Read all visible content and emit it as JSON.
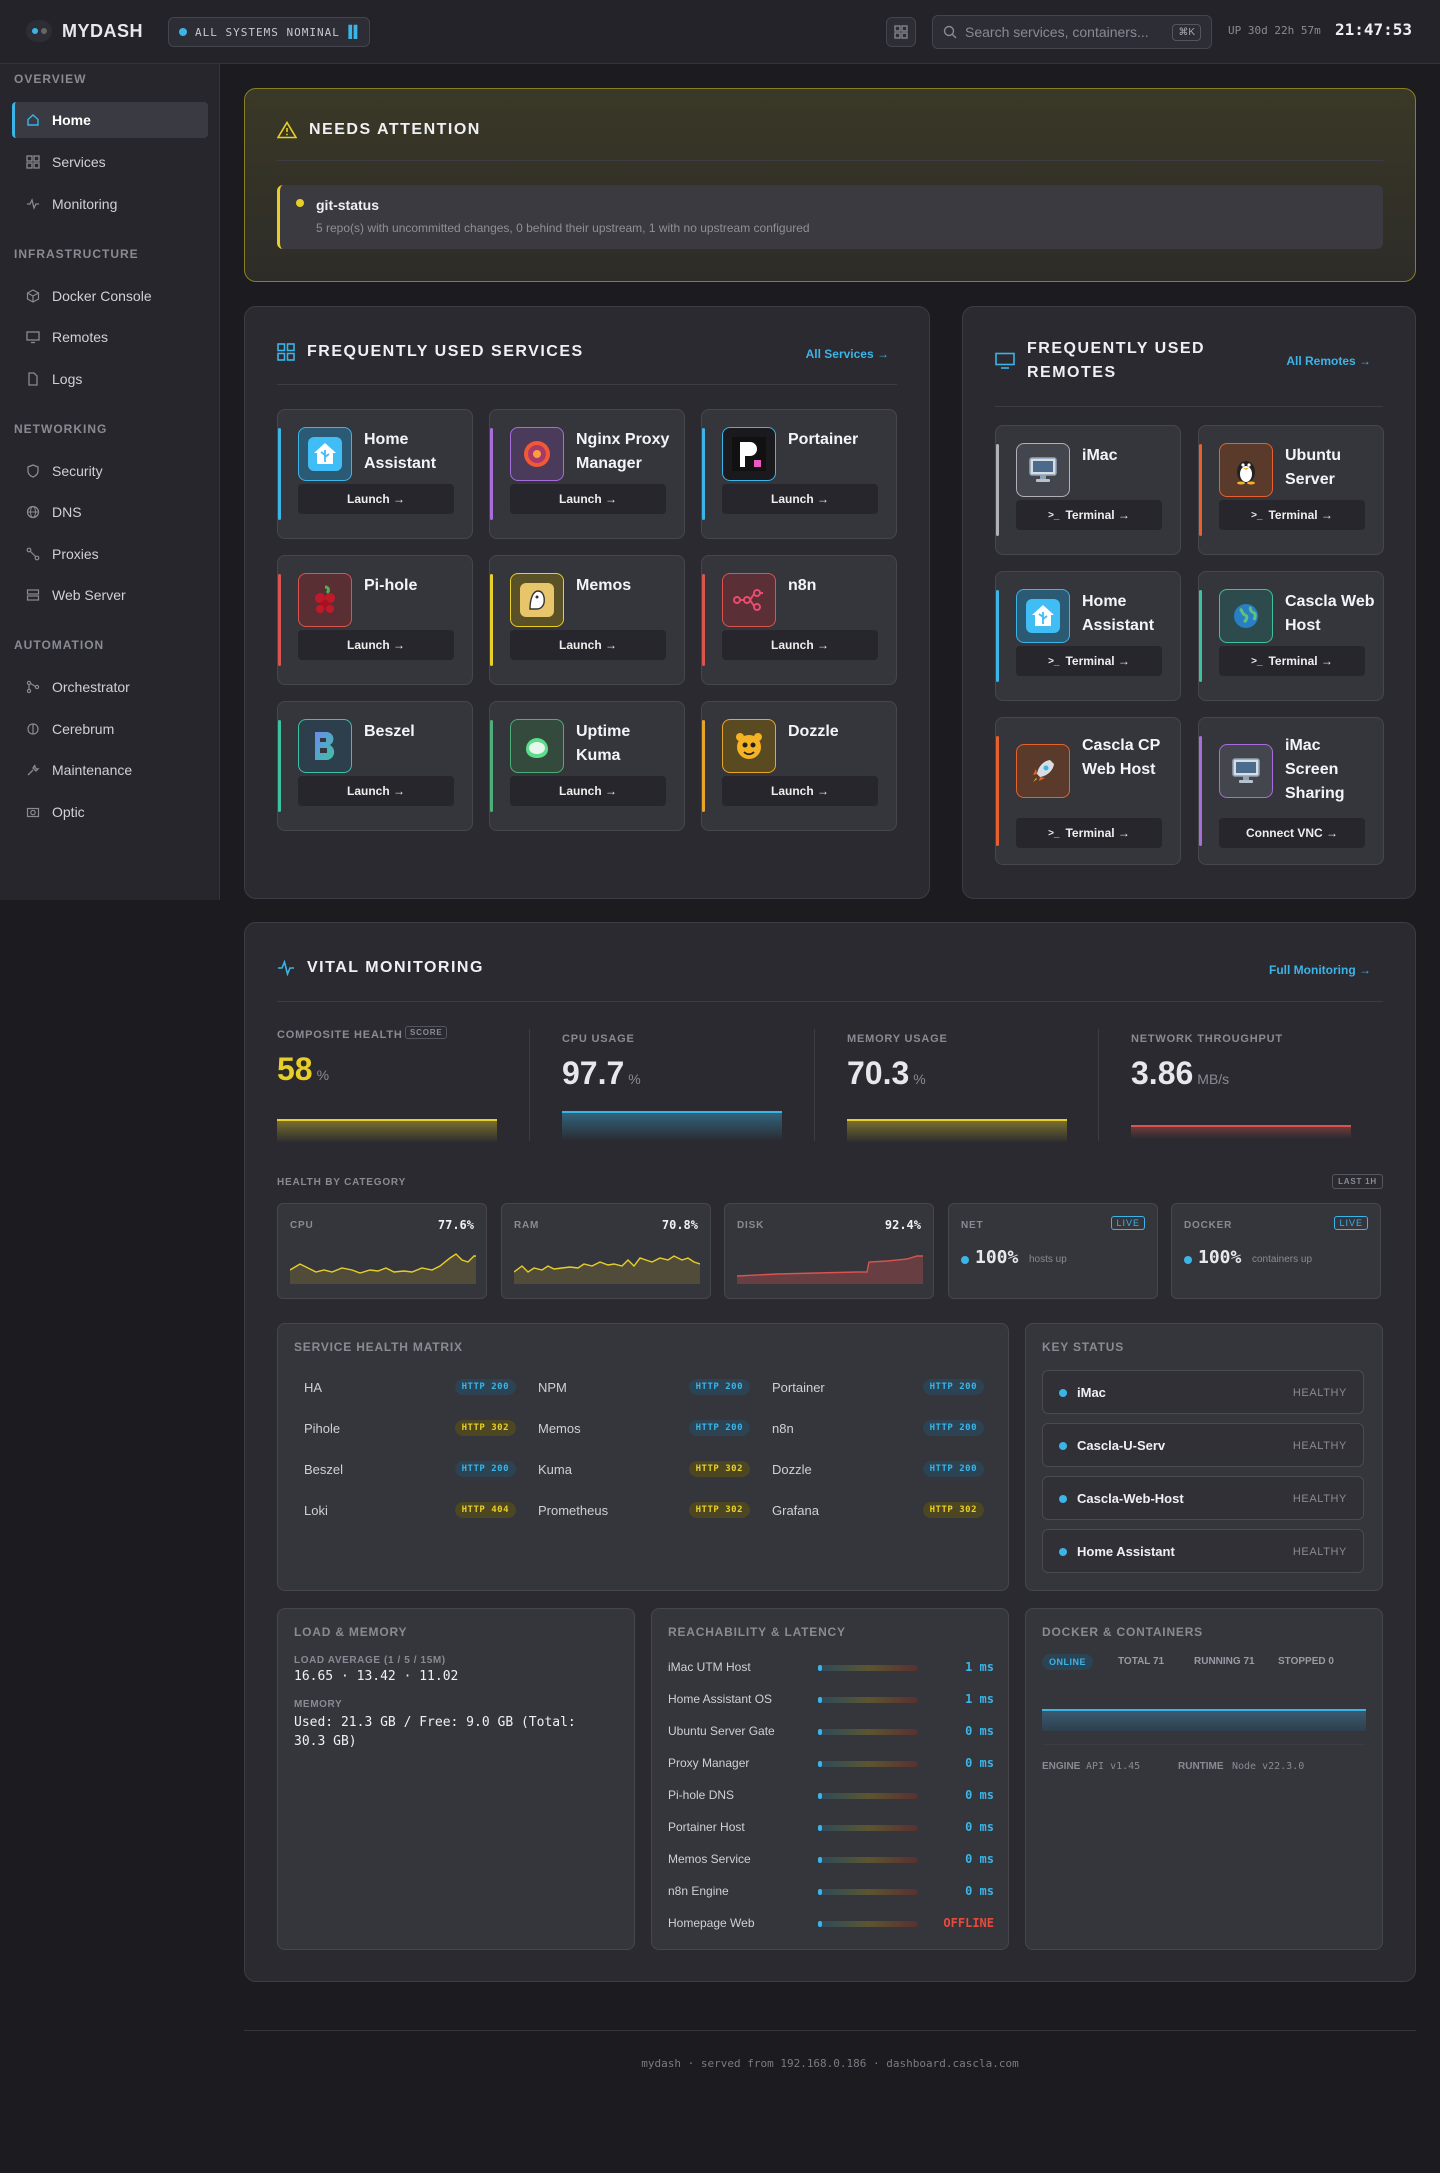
{
  "topbar": {
    "brand": "MYDASH",
    "status": "ALL SYSTEMS NOMINAL",
    "search_placeholder": "Search services, containers...",
    "shortcut": "⌘K",
    "uptime": "UP 30d 22h 57m",
    "clock": "21:47:53"
  },
  "sidebar": {
    "sections": [
      {
        "title": "OVERVIEW",
        "items": [
          "Home",
          "Services",
          "Monitoring"
        ]
      },
      {
        "title": "INFRASTRUCTURE",
        "items": [
          "Docker Console",
          "Remotes",
          "Logs"
        ]
      },
      {
        "title": "NETWORKING",
        "items": [
          "Security",
          "DNS",
          "Proxies",
          "Web Server"
        ]
      },
      {
        "title": "AUTOMATION",
        "items": [
          "Orchestrator",
          "Cerebrum",
          "Maintenance",
          "Optic"
        ]
      }
    ],
    "active": "Home"
  },
  "attention": {
    "title": "NEEDS ATTENTION",
    "item_title": "git-status",
    "item_desc": "5 repo(s) with uncommitted changes, 0 behind their upstream, 1 with no upstream configured"
  },
  "services": {
    "title": "FREQUENTLY USED SERVICES",
    "link": "All Services →",
    "launch_label": "Launch →",
    "items": [
      {
        "name": "Home Assistant",
        "accent": "#3bb4e8",
        "icon": "home-assistant-icon"
      },
      {
        "name": "Nginx Proxy Manager",
        "accent": "#a66ddb",
        "icon": "nginx-proxy-icon"
      },
      {
        "name": "Portainer",
        "accent": "#3bb4e8",
        "icon": "portainer-icon"
      },
      {
        "name": "Pi-hole",
        "accent": "#d9534f",
        "icon": "pihole-icon"
      },
      {
        "name": "Memos",
        "accent": "#e8cf28",
        "icon": "memos-icon"
      },
      {
        "name": "n8n",
        "accent": "#d9534f",
        "icon": "n8n-icon"
      },
      {
        "name": "Beszel",
        "accent": "#3cc2a0",
        "icon": "beszel-icon"
      },
      {
        "name": "Uptime Kuma",
        "accent": "#4caf7a",
        "icon": "uptime-kuma-icon"
      },
      {
        "name": "Dozzle",
        "accent": "#e8a628",
        "icon": "dozzle-icon"
      }
    ]
  },
  "remotes": {
    "title": "FREQUENTLY USED REMOTES",
    "link": "All Remotes →",
    "items": [
      {
        "name": "iMac",
        "action": "Terminal →",
        "accent": "#b0b0b8",
        "icon": "computer-icon"
      },
      {
        "name": "Ubuntu Server",
        "action": "Terminal →",
        "accent": "#e8602c",
        "icon": "penguin-icon"
      },
      {
        "name": "Home Assistant",
        "action": "Terminal →",
        "accent": "#3bb4e8",
        "icon": "home-assistant-icon"
      },
      {
        "name": "Cascla Web Host",
        "action": "Terminal →",
        "accent": "#3cc2a0",
        "icon": "globe-icon"
      },
      {
        "name": "Cascla CP Web Host",
        "action": "Terminal →",
        "accent": "#e8602c",
        "icon": "rocket-icon"
      },
      {
        "name": "iMac Screen Sharing",
        "action": "Connect VNC →",
        "accent": "#a66ddb",
        "icon": "computer-icon"
      }
    ]
  },
  "monitoring": {
    "title": "VITAL MONITORING",
    "link": "Full Monitoring →",
    "metrics": [
      {
        "label": "COMPOSITE HEALTH",
        "tag": "SCORE",
        "value": "58",
        "unit": "%",
        "color": "#e8cf28"
      },
      {
        "label": "CPU USAGE",
        "value": "97.7",
        "unit": "%",
        "color": "#f0f0f4"
      },
      {
        "label": "MEMORY USAGE",
        "value": "70.3",
        "unit": "%",
        "color": "#f0f0f4"
      },
      {
        "label": "NETWORK THROUGHPUT",
        "value": "3.86",
        "unit": "MB/s",
        "color": "#f0f0f4"
      }
    ],
    "health_by_category": "HEALTH BY CATEGORY",
    "last_label": "LAST 1H",
    "categories": [
      {
        "label": "CPU",
        "value": "77.6%"
      },
      {
        "label": "RAM",
        "value": "70.8%"
      },
      {
        "label": "DISK",
        "value": "92.4%"
      },
      {
        "label": "NET",
        "live": "LIVE",
        "big": "100%",
        "sub": "hosts up"
      },
      {
        "label": "DOCKER",
        "live": "LIVE",
        "big": "100%",
        "sub": "containers up"
      }
    ],
    "matrix": {
      "title": "SERVICE HEALTH MATRIX",
      "rows": [
        [
          {
            "name": "HA",
            "code": "HTTP 200"
          },
          {
            "name": "NPM",
            "code": "HTTP 200"
          },
          {
            "name": "Portainer",
            "code": "HTTP 200"
          }
        ],
        [
          {
            "name": "Pihole",
            "code": "HTTP 302"
          },
          {
            "name": "Memos",
            "code": "HTTP 200"
          },
          {
            "name": "n8n",
            "code": "HTTP 200"
          }
        ],
        [
          {
            "name": "Beszel",
            "code": "HTTP 200"
          },
          {
            "name": "Kuma",
            "code": "HTTP 302"
          },
          {
            "name": "Dozzle",
            "code": "HTTP 200"
          }
        ],
        [
          {
            "name": "Loki",
            "code": "HTTP 404"
          },
          {
            "name": "Prometheus",
            "code": "HTTP 302"
          },
          {
            "name": "Grafana",
            "code": "HTTP 302"
          }
        ]
      ]
    },
    "key_status": {
      "title": "KEY STATUS",
      "items": [
        {
          "name": "iMac",
          "state": "HEALTHY"
        },
        {
          "name": "Cascla-U-Serv",
          "state": "HEALTHY"
        },
        {
          "name": "Cascla-Web-Host",
          "state": "HEALTHY"
        },
        {
          "name": "Home Assistant",
          "state": "HEALTHY"
        }
      ]
    },
    "load": {
      "title": "LOAD & MEMORY",
      "load_label": "LOAD AVERAGE (1 / 5 / 15M)",
      "load_value": "16.65 · 13.42 · 11.02",
      "mem_label": "MEMORY",
      "mem_value": "Used: 21.3 GB / Free: 9.0 GB (Total: 30.3 GB)"
    },
    "reach": {
      "title": "REACHABILITY & LATENCY",
      "rows": [
        {
          "name": "iMac UTM Host",
          "value": "1 ms"
        },
        {
          "name": "Home Assistant OS",
          "value": "1 ms"
        },
        {
          "name": "Ubuntu Server Gate",
          "value": "0 ms"
        },
        {
          "name": "Proxy Manager",
          "value": "0 ms"
        },
        {
          "name": "Pi-hole DNS",
          "value": "0 ms"
        },
        {
          "name": "Portainer Host",
          "value": "0 ms"
        },
        {
          "name": "Memos Service",
          "value": "0 ms"
        },
        {
          "name": "n8n Engine",
          "value": "0 ms"
        },
        {
          "name": "Homepage Web",
          "value": "OFFLINE"
        }
      ]
    },
    "docker": {
      "title": "DOCKER & CONTAINERS",
      "online": "ONLINE",
      "total": "TOTAL 71",
      "running": "RUNNING 71",
      "stopped": "STOPPED 0",
      "engine_label": "ENGINE",
      "engine_value": "API v1.45",
      "runtime_label": "RUNTIME",
      "runtime_value": "Node v22.3.0"
    }
  },
  "footer": "mydash · served from 192.168.0.186 · dashboard.cascla.com"
}
